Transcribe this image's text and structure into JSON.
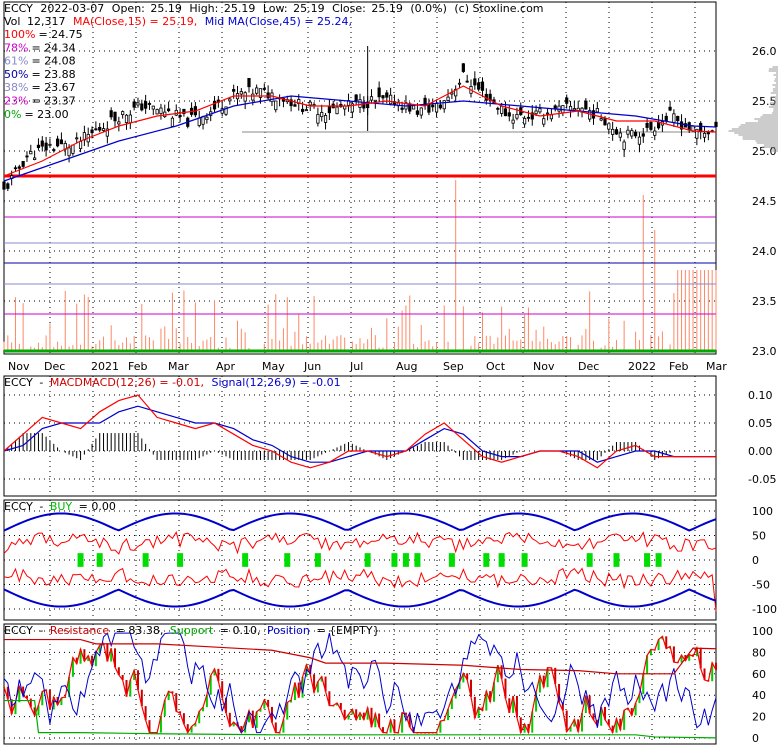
{
  "header": {
    "symbol": "ECCY",
    "date": "2022-03-07",
    "open_label": "Open:",
    "open": "25.19",
    "high_label": "High:",
    "high": "25.19",
    "low_label": "Low:",
    "low": "25.19",
    "close_label": "Close:",
    "close": "25.19",
    "change": "(0.0%)",
    "source": "(c) Stoxline.com",
    "vol_label": "Vol",
    "volume": "12,317",
    "ma_label": "MA(Close,15) = 25.19,",
    "mid_ma_label": "Mid MA(Close,45) = 25.24,"
  },
  "fib_levels": [
    {
      "pct": "100%",
      "value": "= 24.75",
      "color": "#ff0000",
      "price": 24.75
    },
    {
      "pct": "78%",
      "value": "= 24.34",
      "color": "#cc00cc",
      "price": 24.34
    },
    {
      "pct": "61%",
      "value": "= 24.08",
      "color": "#8888cc",
      "price": 24.08
    },
    {
      "pct": "50%",
      "value": "= 23.88",
      "color": "#0000aa",
      "price": 23.88
    },
    {
      "pct": "38%",
      "value": "= 23.67",
      "color": "#8888cc",
      "price": 23.67
    },
    {
      "pct": "23%",
      "value": "= 23.37",
      "color": "#cc00cc",
      "price": 23.37
    },
    {
      "pct": "0%",
      "value": "= 23.00",
      "color": "#00aa00",
      "price": 23.0
    }
  ],
  "colors": {
    "candle": "#000000",
    "ma15": "#ff0000",
    "ma45": "#0000cc",
    "volume": "#ff8866",
    "grid": "#000000",
    "buy": "#00dd00",
    "resistance": "#cc0000",
    "support": "#00aa00",
    "position": "#0000cc"
  },
  "panels": {
    "macd": {
      "symbol": "ECCY",
      "sep": "-",
      "title": "MACD",
      "label": "MACD(12,26) = -0.01,",
      "signal_label": "Signal(12,26,9) = -0.01"
    },
    "buy": {
      "symbol": "ECCY",
      "sep": "-",
      "title": "BUY",
      "value": "= 0.00"
    },
    "rsp": {
      "symbol": "ECCY",
      "sep": "-",
      "resistance_label": "Resistance",
      "resistance_value": "= 83.38,",
      "support_label": "Support",
      "support_value": "= 0.10,",
      "position_label": "Position",
      "position_value": "= {EMPTY}"
    }
  },
  "chart_data": [
    {
      "type": "candlestick",
      "title": "ECCY 2022-03-07",
      "x_ticks": [
        "Nov",
        "Dec",
        "2021",
        "Feb",
        "Mar",
        "Apr",
        "May",
        "Jun",
        "Jul",
        "Aug",
        "Sep",
        "Oct",
        "Nov",
        "Dec",
        "2022",
        "Feb",
        "Mar"
      ],
      "y_ticks": [
        "26.0",
        "25.5",
        "25.0",
        "24.5",
        "24.0",
        "23.5",
        "23.0"
      ],
      "ylim": [
        23.0,
        26.0
      ],
      "close_path": [
        [
          0,
          24.6
        ],
        [
          6,
          24.95
        ],
        [
          12,
          25.05
        ],
        [
          18,
          25.05
        ],
        [
          24,
          25.2
        ],
        [
          30,
          25.35
        ],
        [
          36,
          25.45
        ],
        [
          42,
          25.4
        ],
        [
          48,
          25.3
        ],
        [
          54,
          25.4
        ],
        [
          60,
          25.55
        ],
        [
          66,
          25.6
        ],
        [
          72,
          25.55
        ],
        [
          78,
          25.45
        ],
        [
          84,
          25.4
        ],
        [
          90,
          25.45
        ],
        [
          96,
          25.5
        ],
        [
          102,
          25.5
        ],
        [
          108,
          25.4
        ],
        [
          114,
          25.45
        ],
        [
          120,
          25.75
        ],
        [
          126,
          25.55
        ],
        [
          132,
          25.35
        ],
        [
          138,
          25.35
        ],
        [
          144,
          25.4
        ],
        [
          150,
          25.45
        ],
        [
          156,
          25.35
        ],
        [
          162,
          25.15
        ],
        [
          168,
          25.2
        ],
        [
          174,
          25.35
        ],
        [
          180,
          25.2
        ],
        [
          186,
          25.19
        ]
      ],
      "ma15_path": [
        [
          0,
          24.75
        ],
        [
          10,
          24.9
        ],
        [
          20,
          25.1
        ],
        [
          30,
          25.25
        ],
        [
          40,
          25.35
        ],
        [
          50,
          25.4
        ],
        [
          60,
          25.55
        ],
        [
          70,
          25.55
        ],
        [
          80,
          25.45
        ],
        [
          90,
          25.45
        ],
        [
          100,
          25.5
        ],
        [
          110,
          25.45
        ],
        [
          120,
          25.65
        ],
        [
          130,
          25.45
        ],
        [
          140,
          25.35
        ],
        [
          150,
          25.4
        ],
        [
          160,
          25.3
        ],
        [
          170,
          25.3
        ],
        [
          180,
          25.2
        ],
        [
          186,
          25.19
        ]
      ],
      "ma45_path": [
        [
          0,
          24.7
        ],
        [
          15,
          24.9
        ],
        [
          30,
          25.1
        ],
        [
          45,
          25.25
        ],
        [
          60,
          25.45
        ],
        [
          75,
          25.55
        ],
        [
          90,
          25.5
        ],
        [
          105,
          25.45
        ],
        [
          120,
          25.5
        ],
        [
          135,
          25.45
        ],
        [
          150,
          25.4
        ],
        [
          165,
          25.35
        ],
        [
          180,
          25.25
        ],
        [
          186,
          25.24
        ]
      ]
    },
    {
      "type": "line",
      "title": "MACD",
      "y_ticks": [
        "0.10",
        "0.05",
        "0.00",
        "-0.05"
      ],
      "ylim": [
        -0.07,
        0.12
      ],
      "macd": [
        [
          0,
          0.0
        ],
        [
          5,
          0.03
        ],
        [
          10,
          0.06
        ],
        [
          15,
          0.05
        ],
        [
          20,
          0.04
        ],
        [
          25,
          0.07
        ],
        [
          30,
          0.09
        ],
        [
          35,
          0.1
        ],
        [
          40,
          0.06
        ],
        [
          45,
          0.05
        ],
        [
          50,
          0.04
        ],
        [
          55,
          0.05
        ],
        [
          60,
          0.03
        ],
        [
          65,
          0.01
        ],
        [
          70,
          0.0
        ],
        [
          75,
          -0.02
        ],
        [
          80,
          -0.03
        ],
        [
          85,
          -0.02
        ],
        [
          90,
          0.0
        ],
        [
          95,
          0.0
        ],
        [
          100,
          -0.01
        ],
        [
          105,
          0.0
        ],
        [
          110,
          0.03
        ],
        [
          115,
          0.05
        ],
        [
          120,
          0.02
        ],
        [
          125,
          -0.01
        ],
        [
          130,
          -0.02
        ],
        [
          135,
          -0.01
        ],
        [
          140,
          0.0
        ],
        [
          145,
          0.0
        ],
        [
          150,
          -0.01
        ],
        [
          155,
          -0.03
        ],
        [
          160,
          0.0
        ],
        [
          165,
          0.01
        ],
        [
          170,
          -0.01
        ],
        [
          175,
          -0.01
        ],
        [
          180,
          -0.01
        ],
        [
          186,
          -0.01
        ]
      ],
      "signal": [
        [
          0,
          0.0
        ],
        [
          5,
          0.01
        ],
        [
          10,
          0.04
        ],
        [
          15,
          0.05
        ],
        [
          20,
          0.05
        ],
        [
          25,
          0.05
        ],
        [
          30,
          0.07
        ],
        [
          35,
          0.08
        ],
        [
          40,
          0.07
        ],
        [
          45,
          0.06
        ],
        [
          50,
          0.05
        ],
        [
          55,
          0.05
        ],
        [
          60,
          0.04
        ],
        [
          65,
          0.02
        ],
        [
          70,
          0.01
        ],
        [
          75,
          -0.01
        ],
        [
          80,
          -0.02
        ],
        [
          85,
          -0.02
        ],
        [
          90,
          -0.01
        ],
        [
          95,
          0.0
        ],
        [
          100,
          0.0
        ],
        [
          105,
          0.0
        ],
        [
          110,
          0.02
        ],
        [
          115,
          0.04
        ],
        [
          120,
          0.03
        ],
        [
          125,
          0.0
        ],
        [
          130,
          -0.01
        ],
        [
          135,
          -0.01
        ],
        [
          140,
          0.0
        ],
        [
          145,
          0.0
        ],
        [
          150,
          0.0
        ],
        [
          155,
          -0.02
        ],
        [
          160,
          -0.01
        ],
        [
          165,
          0.0
        ],
        [
          170,
          0.0
        ],
        [
          175,
          -0.01
        ],
        [
          180,
          -0.01
        ],
        [
          186,
          -0.01
        ]
      ]
    },
    {
      "type": "line",
      "title": "BUY",
      "y_ticks": [
        "100",
        "50",
        "0",
        "-50",
        "-100"
      ],
      "ylim": [
        -110,
        110
      ],
      "buy_markers_x": [
        20,
        25,
        37,
        46,
        63,
        74,
        82,
        95,
        102,
        105,
        108,
        117,
        126,
        130,
        136,
        153,
        160,
        168,
        171
      ]
    },
    {
      "type": "line",
      "title": "Resistance / Support / Position",
      "y_ticks": [
        "100",
        "80",
        "60",
        "40",
        "20",
        "0"
      ],
      "ylim": [
        0,
        100
      ],
      "resistance": [
        [
          0,
          92
        ],
        [
          20,
          92
        ],
        [
          24,
          88
        ],
        [
          40,
          88
        ],
        [
          55,
          85
        ],
        [
          70,
          82
        ],
        [
          80,
          75
        ],
        [
          84,
          70
        ],
        [
          100,
          70
        ],
        [
          120,
          68
        ],
        [
          135,
          64
        ],
        [
          150,
          63
        ],
        [
          160,
          60
        ],
        [
          175,
          60
        ],
        [
          180,
          84
        ],
        [
          186,
          83.38
        ]
      ],
      "support": [
        [
          0,
          35
        ],
        [
          8,
          35
        ],
        [
          9,
          5
        ],
        [
          20,
          5
        ],
        [
          40,
          4
        ],
        [
          70,
          3
        ],
        [
          100,
          3
        ],
        [
          120,
          3
        ],
        [
          150,
          3
        ],
        [
          165,
          3
        ],
        [
          170,
          1
        ],
        [
          186,
          0.1
        ]
      ]
    }
  ]
}
